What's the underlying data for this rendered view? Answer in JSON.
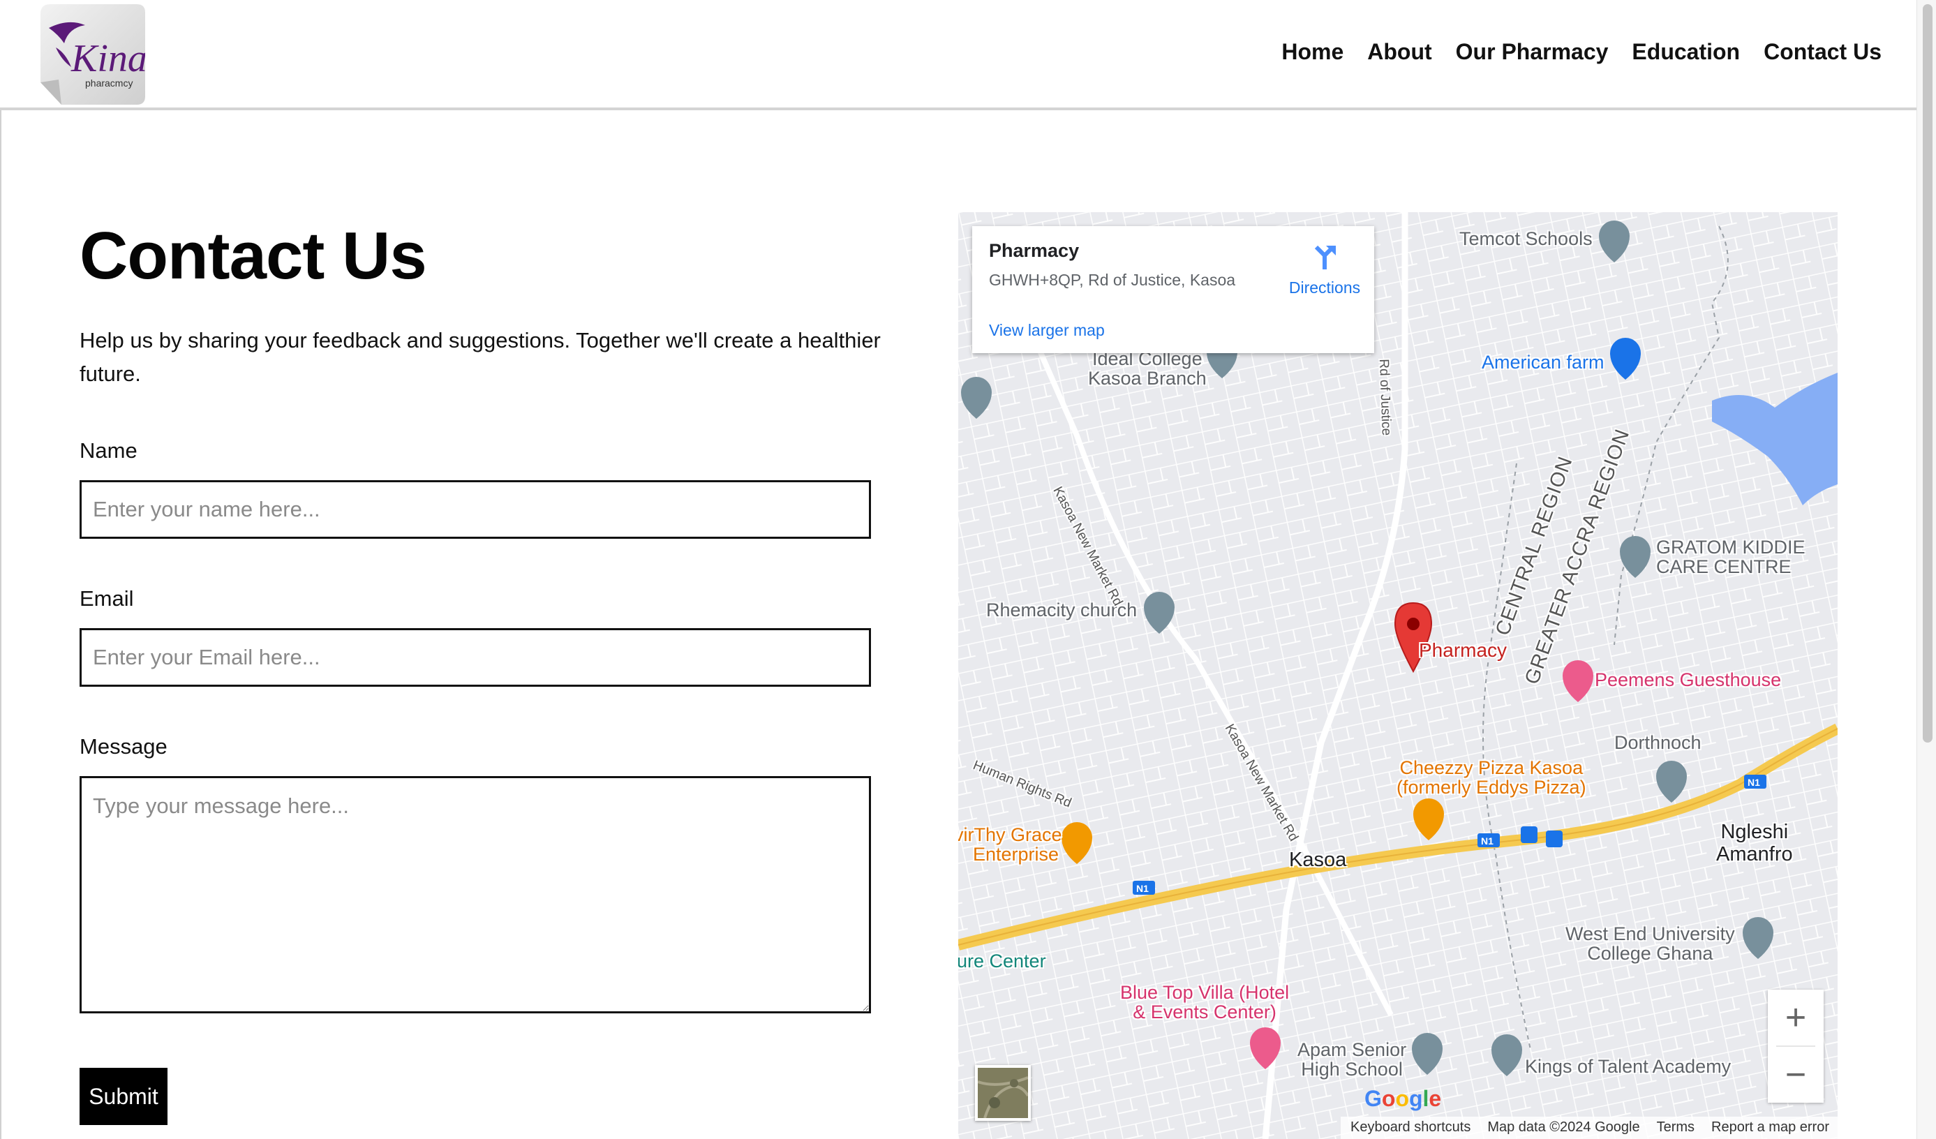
{
  "header": {
    "logo_text": "Kina",
    "logo_subtext": "pharacmcy",
    "nav": [
      "Home",
      "About",
      "Our Pharmacy",
      "Education",
      "Contact Us"
    ]
  },
  "form": {
    "title": "Contact Us",
    "intro": "Help us by sharing your feedback and suggestions. Together we'll create a healthier future.",
    "name_label": "Name",
    "name_placeholder": "Enter your name here...",
    "email_label": "Email",
    "email_placeholder": "Enter your Email here...",
    "message_label": "Message",
    "message_placeholder": "Type your message here...",
    "submit": "Submit"
  },
  "map": {
    "info_title": "Pharmacy",
    "info_address": "GHWH+8QP, Rd of Justice, Kasoa",
    "directions": "Directions",
    "larger_map": "View larger map",
    "labels": {
      "temcot": "Temcot Schools",
      "ideal": "Ideal College Kasoa Branch",
      "ideal_line1": "Ideal College",
      "ideal_line2": "Kasoa Branch",
      "american": "American farm",
      "gratom_line1": "GRATOM KIDDIE",
      "gratom_line2": "CARE CENTRE",
      "rhemacity": "Rhemacity church",
      "pharmacy": "Pharmacy",
      "peemens": "Peemens Guesthouse",
      "dorthnoch": "Dorthnoch",
      "cheezzy_line1": "Cheezzy Pizza Kasoa",
      "cheezzy_line2": "(formerly Eddys Pizza)",
      "thygrace_line1": "virThy Grace",
      "thygrace_line2": "Enterprise",
      "kasoa": "Kasoa",
      "ngleshi_line1": "Ngleshi",
      "ngleshi_line2": "Amanfro",
      "westend_line1": "West End University",
      "westend_line2": "College Ghana",
      "recenter": "ure Center",
      "bluetop_line1": "Blue Top Villa (Hotel",
      "bluetop_line2": "& Events Center)",
      "apam_line1": "Apam Senior",
      "apam_line2": "High School",
      "kings": "Kings of Talent Academy",
      "road_market1": "Kasoa New Market Rd",
      "road_market2": "Kasoa New Market Rd",
      "road_justice": "Rd of Justice",
      "road_human": "Human Rights Rd",
      "region_central": "CENTRAL REGION",
      "region_accra": "GREATER ACCRA REGION",
      "n1": "N1"
    },
    "zoom_in": "+",
    "zoom_out": "−",
    "google": "Google",
    "attribution": [
      "Keyboard shortcuts",
      "Map data ©2024 Google",
      "Terms",
      "Report a map error"
    ]
  },
  "colors": {
    "brand_purple": "#5b1a78",
    "highway": "#f5c94f",
    "water": "#86aef5",
    "map_bg": "#e9eaee",
    "pin_red": "#e53935",
    "link_blue": "#1a73e8"
  }
}
